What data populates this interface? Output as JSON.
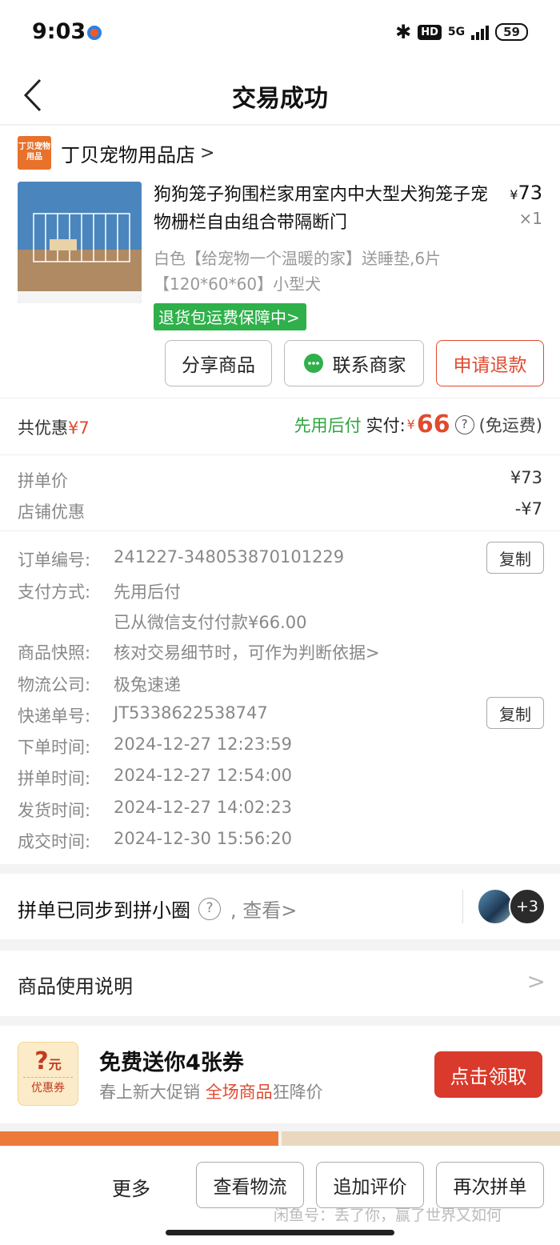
{
  "status_bar": {
    "time": "9:03",
    "network": "5G",
    "hd": "HD",
    "battery": "59"
  },
  "nav": {
    "title": "交易成功"
  },
  "shop": {
    "logo_text": "丁贝宠物用品",
    "name": "丁贝宠物用品店"
  },
  "product": {
    "title": "狗狗笼子狗围栏家用室内中大型犬狗笼子宠物栅栏自由组合带隔断门",
    "price_symbol": "¥",
    "price": "73",
    "quantity": "×1",
    "spec": "白色【给宠物一个温暖的家】送睡垫,6片【120*60*60】小型犬",
    "badge": "退货包运费保障中>"
  },
  "actions": {
    "share": "分享商品",
    "contact": "联系商家",
    "refund": "申请退款"
  },
  "summary": {
    "discount_label": "共优惠",
    "discount_value": "¥7",
    "pay_later": "先用后付",
    "paid_label": "实付:",
    "currency": "¥",
    "paid_amount": "66",
    "help": "?",
    "shipping": "(免运费)"
  },
  "prices": [
    {
      "label": "拼单价",
      "value": "¥73"
    },
    {
      "label": "店铺优惠",
      "value": "-¥7"
    }
  ],
  "order_info": {
    "order_no_label": "订单编号:",
    "order_no": "241227-348053870101229",
    "copy": "复制",
    "payment_label": "支付方式:",
    "payment_method": "先用后付",
    "payment_detail": "已从微信支付付款¥66.00",
    "snapshot_label": "商品快照:",
    "snapshot_value": "核对交易细节时，可作为判断依据>",
    "courier_label": "物流公司:",
    "courier": "极兔速递",
    "tracking_label": "快递单号:",
    "tracking_no": "JT5338622538747",
    "times": [
      {
        "label": "下单时间:",
        "value": "2024-12-27 12:23:59"
      },
      {
        "label": "拼单时间:",
        "value": "2024-12-27 12:54:00"
      },
      {
        "label": "发货时间:",
        "value": "2024-12-27 14:02:23"
      },
      {
        "label": "成交时间:",
        "value": "2024-12-30 15:56:20"
      }
    ]
  },
  "group_sync": {
    "text": "拼单已同步到拼小圈",
    "help": "?",
    "view": ", 查看>",
    "avatar_count": "+3"
  },
  "instructions": {
    "text": "商品使用说明",
    "chevron": ">"
  },
  "coupon": {
    "icon_amount": "?",
    "icon_unit": "元",
    "icon_label": "优惠券",
    "title": "免费送你4张券",
    "subtitle_prefix": "春上新大促销 ",
    "subtitle_highlight": "全场商品",
    "subtitle_suffix": "狂降价",
    "button": "点击领取"
  },
  "bottom_bar": {
    "more": "更多",
    "logistics": "查看物流",
    "review": "追加评价",
    "rebuy": "再次拼单",
    "watermark": "闲鱼号：丢了你，赢了世界又如何"
  },
  "colors": {
    "accent_red": "#e04a2f",
    "pay_green": "#2fa43f",
    "badge_green": "#2fb04b",
    "shop_orange": "#e8712b"
  }
}
